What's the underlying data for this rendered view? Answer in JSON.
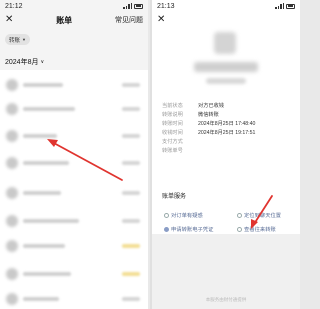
{
  "left_screen": {
    "status_time": "21:12",
    "title": "账单",
    "help_link": "常见问题",
    "filter_chip": "转账",
    "month": "2024年8月"
  },
  "right_screen": {
    "status_time": "21:13",
    "details": [
      {
        "label": "当前状态",
        "value": "对方已收钱"
      },
      {
        "label": "转账说明",
        "value": "微信转账"
      },
      {
        "label": "转账时间",
        "value": "2024年8月25日 17:48:40"
      },
      {
        "label": "收钱时间",
        "value": "2024年8月25日 19:17:51"
      },
      {
        "label": "支付方式",
        "value": ""
      },
      {
        "label": "转账单号",
        "value": ""
      }
    ],
    "service_title": "账单服务",
    "services": [
      {
        "label": "对订单有疑惑",
        "icon": "question-circle-icon"
      },
      {
        "label": "定位到聊天位置",
        "icon": "locate-icon"
      },
      {
        "label": "申请转账电子凭证",
        "icon": "document-icon"
      },
      {
        "label": "查看往来转账",
        "icon": "history-icon"
      }
    ],
    "footer": "本服务由财付通提供"
  },
  "colors": {
    "annotation_arrow": "#e0342f",
    "link_blue": "#576b95"
  }
}
